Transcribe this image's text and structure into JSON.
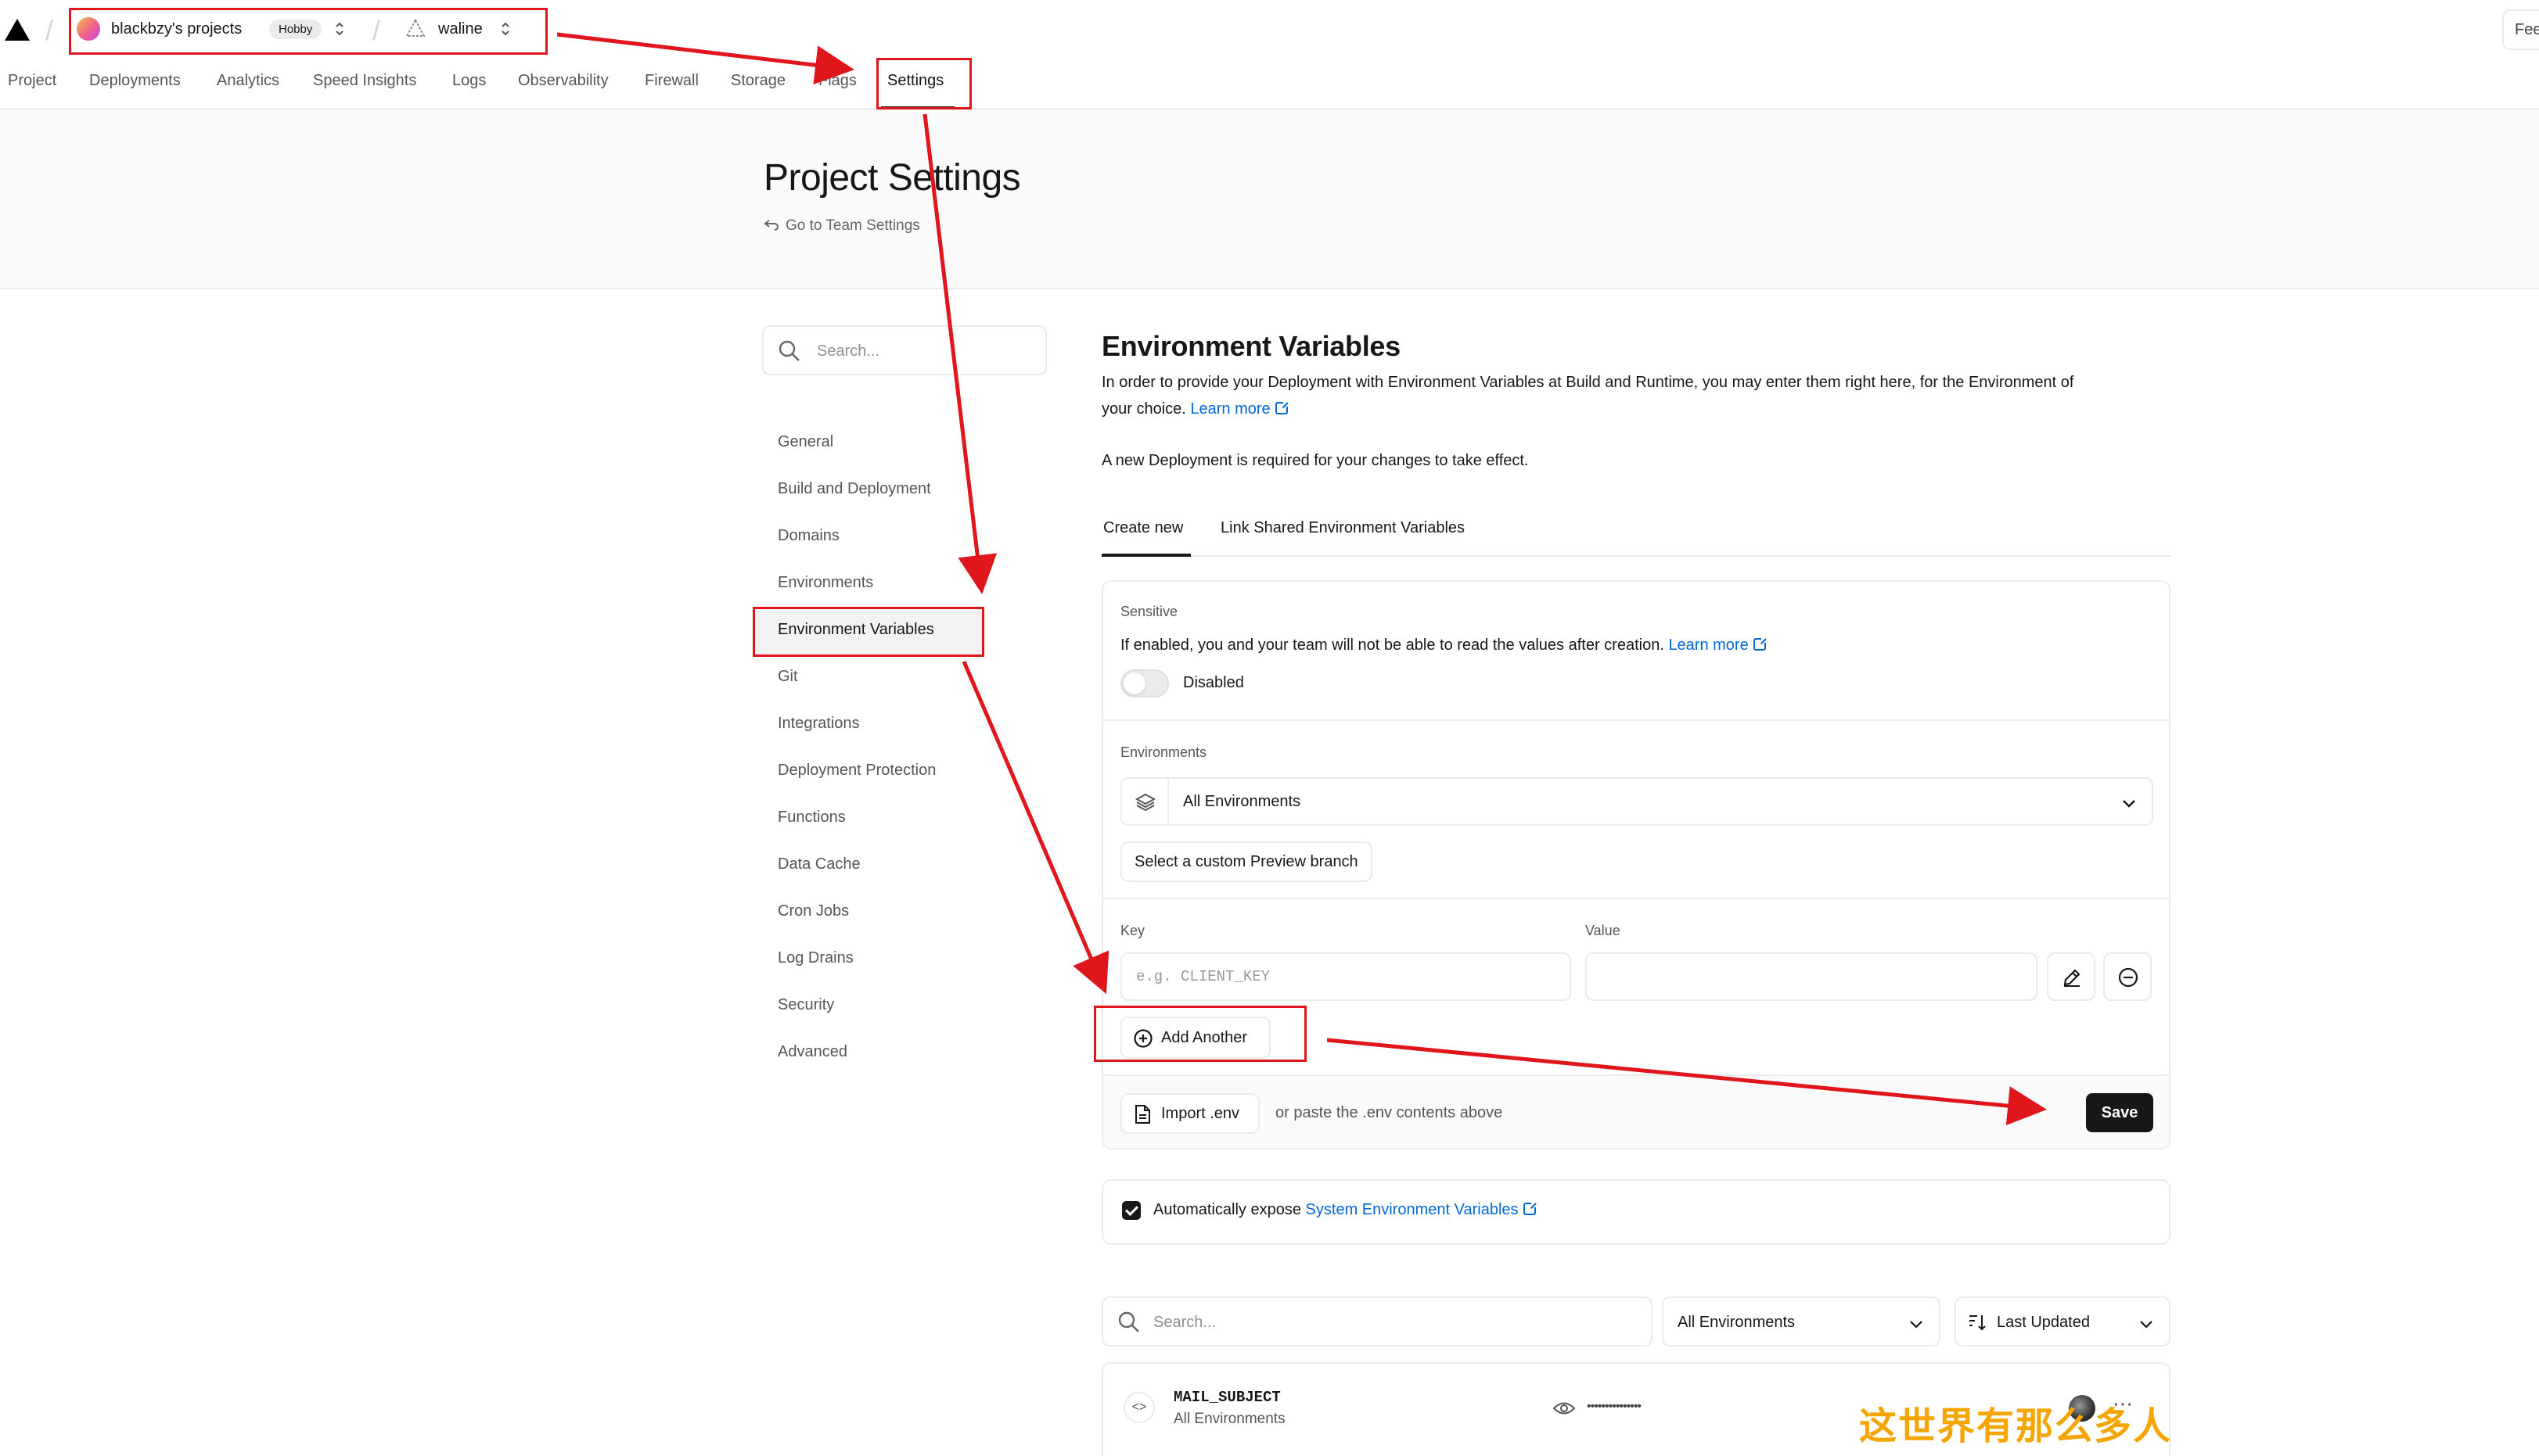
{
  "topbar": {
    "team_name": "blackbzy's projects",
    "plan_badge": "Hobby",
    "project_name": "waline",
    "feedback_label": "Fee"
  },
  "nav": [
    "Project",
    "Deployments",
    "Analytics",
    "Speed Insights",
    "Logs",
    "Observability",
    "Firewall",
    "Storage",
    "Flags",
    "Settings"
  ],
  "header": {
    "title": "Project Settings",
    "back_link": "Go to Team Settings"
  },
  "sidebar": {
    "search_placeholder": "Search...",
    "items": [
      "General",
      "Build and Deployment",
      "Domains",
      "Environments",
      "Environment Variables",
      "Git",
      "Integrations",
      "Deployment Protection",
      "Functions",
      "Data Cache",
      "Cron Jobs",
      "Log Drains",
      "Security",
      "Advanced"
    ],
    "active": "Environment Variables"
  },
  "main": {
    "title": "Environment Variables",
    "description": "In order to provide your Deployment with Environment Variables at Build and Runtime, you may enter them right here, for the Environment of",
    "description_2": "your choice.",
    "learn_more": "Learn more",
    "redeploy_note": "A new Deployment is required for your changes to take effect.",
    "tabs": [
      "Create new",
      "Link Shared Environment Variables"
    ],
    "sensitive": {
      "label": "Sensitive",
      "text": "If enabled, you and your team will not be able to read the values after creation.",
      "learn_more": "Learn more",
      "toggle_label": "Disabled"
    },
    "environments": {
      "label": "Environments",
      "selected": "All Environments",
      "custom_branch_button": "Select a custom Preview branch"
    },
    "kv": {
      "key_label": "Key",
      "value_label": "Value",
      "key_placeholder": "e.g. CLIENT_KEY",
      "add_another": "Add Another"
    },
    "footer": {
      "import_button": "Import .env",
      "paste_hint": "or paste the .env contents above",
      "save_button": "Save"
    },
    "auto_expose": {
      "text": "Automatically expose",
      "link": "System Environment Variables"
    },
    "list": {
      "search_placeholder": "Search...",
      "env_filter": "All Environments",
      "sort": "Last Updated",
      "rows": [
        {
          "name": "MAIL_SUBJECT",
          "envs": "All Environments",
          "value_masked": "•••••••••••••••"
        }
      ]
    }
  },
  "watermark": "这世界有那么多人",
  "annotation_color": "#e0161d"
}
